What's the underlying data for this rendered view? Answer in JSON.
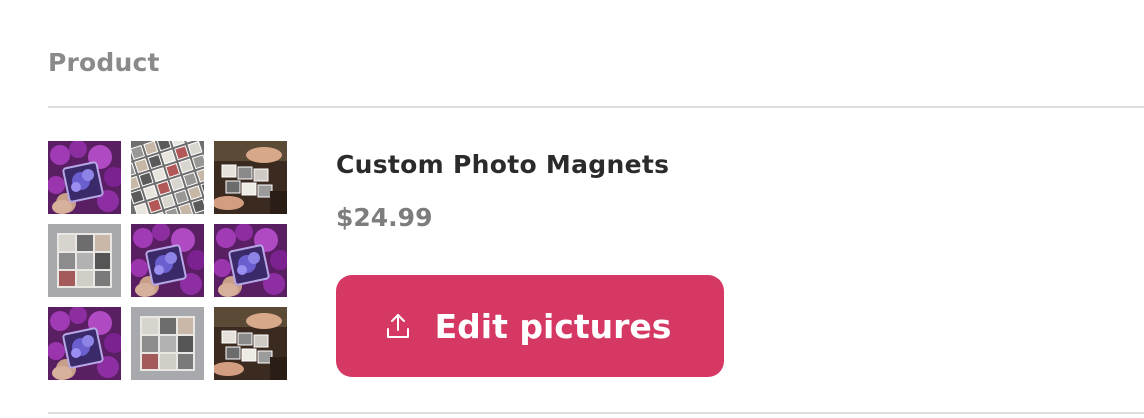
{
  "table": {
    "column_header": "Product"
  },
  "product": {
    "name": "Custom Photo Magnets",
    "price": "$24.99",
    "edit_button_label": "Edit pictures",
    "edit_button_icon": "upload-icon",
    "accent_color": "#d63864",
    "thumbnails": [
      {
        "kind": "purple-flower-magnet"
      },
      {
        "kind": "magnet-grid-collection"
      },
      {
        "kind": "hands-arranging-magnets"
      },
      {
        "kind": "magnet-collage-on-gray"
      },
      {
        "kind": "purple-flower-magnet"
      },
      {
        "kind": "purple-flower-magnet"
      },
      {
        "kind": "purple-flower-magnet"
      },
      {
        "kind": "magnet-collage-on-gray"
      },
      {
        "kind": "hands-arranging-magnets"
      }
    ]
  }
}
